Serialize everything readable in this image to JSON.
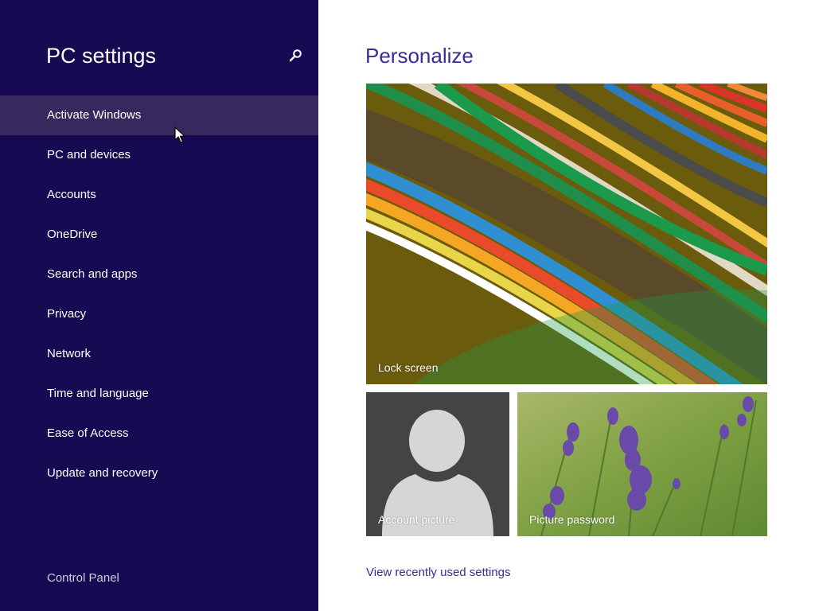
{
  "sidebar": {
    "title": "PC settings",
    "search_icon": "search-icon",
    "items": [
      {
        "label": "Activate Windows",
        "selected": true
      },
      {
        "label": "PC and devices",
        "selected": false
      },
      {
        "label": "Accounts",
        "selected": false
      },
      {
        "label": "OneDrive",
        "selected": false
      },
      {
        "label": "Search and apps",
        "selected": false
      },
      {
        "label": "Privacy",
        "selected": false
      },
      {
        "label": "Network",
        "selected": false
      },
      {
        "label": "Time and language",
        "selected": false
      },
      {
        "label": "Ease of Access",
        "selected": false
      },
      {
        "label": "Update and recovery",
        "selected": false
      }
    ],
    "control_panel": "Control Panel"
  },
  "main": {
    "title": "Personalize",
    "tiles": {
      "lock_screen": "Lock screen",
      "account_picture": "Account picture",
      "picture_password": "Picture password"
    },
    "recent_link": "View recently used settings"
  },
  "colors": {
    "sidebar_bg": "#180a52",
    "selected_item_bg": "#35295e",
    "accent": "#3c2a9a"
  }
}
